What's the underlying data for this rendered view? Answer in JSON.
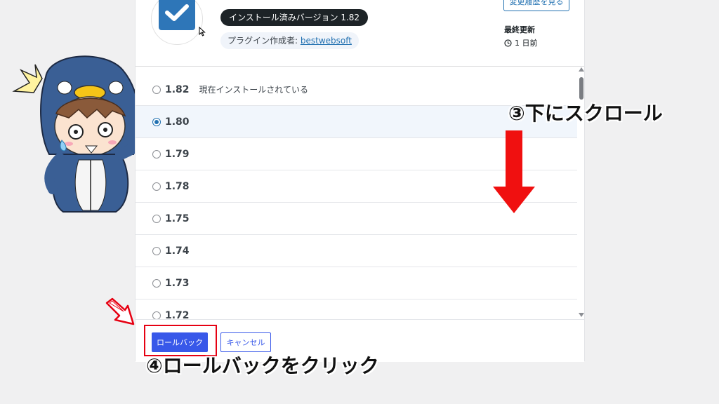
{
  "plugin": {
    "installed_version_badge": "インストール済みバージョン 1.82",
    "author_prefix": "プラグイン作成者: ",
    "author_link": "bestwebsoft",
    "changelog_button": "変更履歴を見る",
    "last_updated_label": "最終更新",
    "last_updated_value": "1 日前"
  },
  "versions": [
    {
      "num": "1.82",
      "note": "現在インストールされている",
      "checked": false
    },
    {
      "num": "1.80",
      "note": "",
      "checked": true
    },
    {
      "num": "1.79",
      "note": "",
      "checked": false
    },
    {
      "num": "1.78",
      "note": "",
      "checked": false
    },
    {
      "num": "1.75",
      "note": "",
      "checked": false
    },
    {
      "num": "1.74",
      "note": "",
      "checked": false
    },
    {
      "num": "1.73",
      "note": "",
      "checked": false
    },
    {
      "num": "1.72",
      "note": "",
      "checked": false
    }
  ],
  "footer": {
    "rollback_button": "ロールバック",
    "cancel_button": "キャンセル"
  },
  "annotations": {
    "step3": "③下にスクロール",
    "step4": "④ロールバックをクリック"
  },
  "colors": {
    "primary": "#3858e9",
    "highlight": "#e60012",
    "plugin_icon": "#2e76b8"
  }
}
